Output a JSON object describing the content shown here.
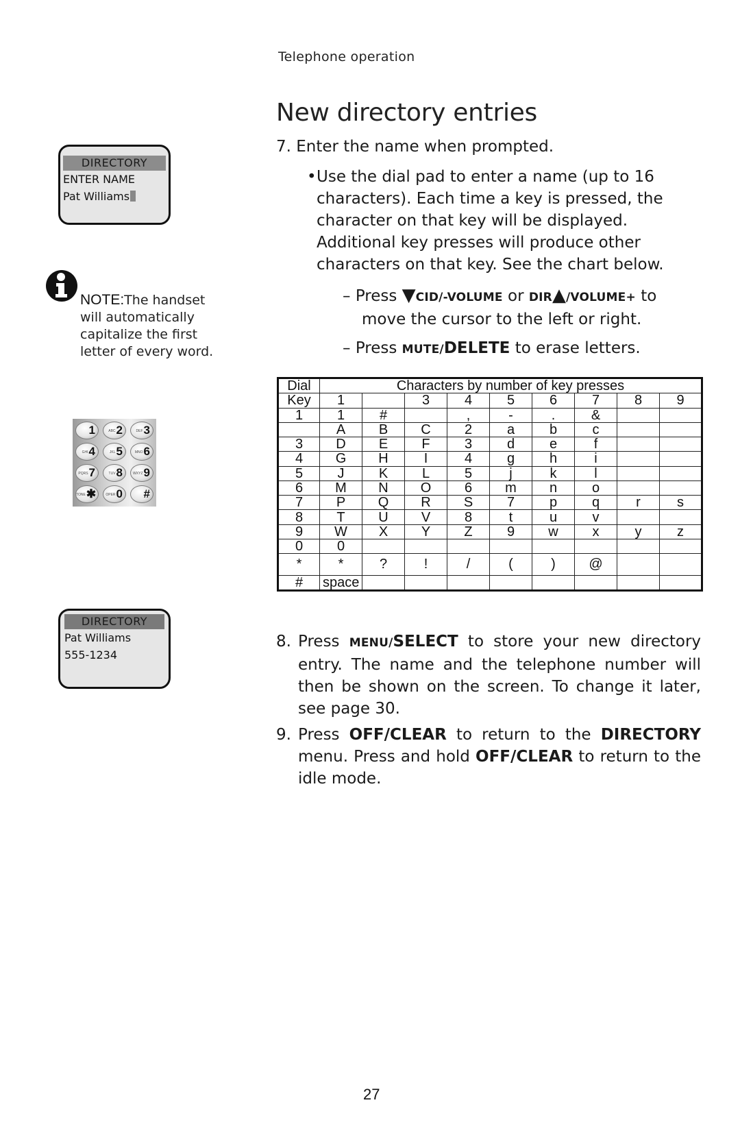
{
  "header": {
    "section": "Telephone operation",
    "title": "New directory entries"
  },
  "step7": {
    "number": "7.",
    "text": "Enter the name when prompted.",
    "bullet": "Use the dial pad to enter a name (up to 16 characters). Each time a key is pressed, the character on that key will be displayed. Additional key presses will produce other characters on that key. See the chart below.",
    "dash1": {
      "prefix": "Press",
      "key1": "CID/-VOLUME",
      "or": "or",
      "key2_a": "DIR",
      "key2_b": "/VOLUME+",
      "suffix": "to",
      "line2": "move the cursor to the left or right."
    },
    "dash2": {
      "prefix": "Press",
      "key_small": "MUTE/",
      "key_big": "DELETE",
      "suffix": "to erase letters."
    }
  },
  "chart_data": {
    "type": "table",
    "title": "Characters by number of key presses",
    "row_header_label_line1": "Dial",
    "row_header_label_line2": "Key",
    "columns": [
      "1",
      "",
      "3",
      "4",
      "5",
      "6",
      "7",
      "8",
      "9"
    ],
    "rows": [
      {
        "key": "1",
        "chars": [
          "1",
          "#",
          "",
          ",",
          "-",
          ".",
          "&",
          "",
          ""
        ]
      },
      {
        "key": "",
        "chars": [
          "A",
          "B",
          "C",
          "2",
          "a",
          "b",
          "c",
          "",
          ""
        ]
      },
      {
        "key": "3",
        "chars": [
          "D",
          "E",
          "F",
          "3",
          "d",
          "e",
          "f",
          "",
          ""
        ]
      },
      {
        "key": "4",
        "chars": [
          "G",
          "H",
          "I",
          "4",
          "g",
          "h",
          "i",
          "",
          ""
        ]
      },
      {
        "key": "5",
        "chars": [
          "J",
          "K",
          "L",
          "5",
          "j",
          "k",
          "l",
          "",
          ""
        ]
      },
      {
        "key": "6",
        "chars": [
          "M",
          "N",
          "O",
          "6",
          "m",
          "n",
          "o",
          "",
          ""
        ]
      },
      {
        "key": "7",
        "chars": [
          "P",
          "Q",
          "R",
          "S",
          "7",
          "p",
          "q",
          "r",
          "s"
        ]
      },
      {
        "key": "8",
        "chars": [
          "T",
          "U",
          "V",
          "8",
          "t",
          "u",
          "v",
          "",
          ""
        ]
      },
      {
        "key": "9",
        "chars": [
          "W",
          "X",
          "Y",
          "Z",
          "9",
          "w",
          "x",
          "y",
          "z"
        ]
      },
      {
        "key": "0",
        "chars": [
          "0",
          "",
          "",
          "",
          "",
          "",
          "",
          "",
          ""
        ]
      },
      {
        "key": "*",
        "chars": [
          "*",
          "?",
          "!",
          "/",
          "(",
          ")",
          "@",
          "",
          ""
        ]
      },
      {
        "key": "#",
        "chars": [
          "space",
          "",
          "",
          "",
          "",
          "",
          "",
          "",
          ""
        ]
      }
    ]
  },
  "step8": {
    "number": "8.",
    "prefix": "Press",
    "key_small": "MENU/",
    "key_big": "SELECT",
    "text": "to store your new directory entry. The name and the telephone number will then be shown on the screen. To change it later, see page 30."
  },
  "step9": {
    "number": "9.",
    "p1": "Press",
    "k1": "OFF/CLEAR",
    "p2": "to return to the",
    "k2": "DIRECTORY",
    "p3": "menu. Press and hold",
    "k3": "OFF/CLEAR",
    "p4": "to return to the idle mode."
  },
  "lcd_enter": {
    "title": "DIRECTORY",
    "line1": "ENTER NAME",
    "line2": "Pat Williams"
  },
  "note": {
    "lead": "NOTE:",
    "lines": [
      "The handset",
      "will automatically",
      "capitalize the first",
      "letter of every word."
    ]
  },
  "keypad": {
    "keys": [
      {
        "digit": "1",
        "letters": ""
      },
      {
        "digit": "2",
        "letters": "ABC"
      },
      {
        "digit": "3",
        "letters": "DEF"
      },
      {
        "digit": "4",
        "letters": "GHI"
      },
      {
        "digit": "5",
        "letters": "JKL"
      },
      {
        "digit": "6",
        "letters": "MNO"
      },
      {
        "digit": "7",
        "letters": "PQRS"
      },
      {
        "digit": "8",
        "letters": "TUV"
      },
      {
        "digit": "9",
        "letters": "WXYZ"
      },
      {
        "digit": "✱",
        "letters": "TONE"
      },
      {
        "digit": "0",
        "letters": "OPER"
      },
      {
        "digit": "#",
        "letters": ""
      }
    ]
  },
  "lcd_saved": {
    "title": "DIRECTORY",
    "line1": "Pat Williams",
    "line2": "555-1234"
  },
  "footer": {
    "page_number": "27"
  }
}
